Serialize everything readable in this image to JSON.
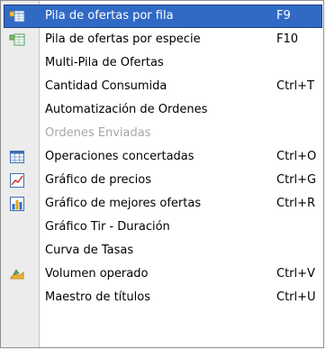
{
  "menu": {
    "items": [
      {
        "label": "Pila de ofertas por fila",
        "shortcut": "F9",
        "icon": "table-list-icon"
      },
      {
        "label": "Pila de ofertas por especie",
        "shortcut": "F10",
        "icon": "table-list-icon"
      },
      {
        "label": "Multi-Pila de Ofertas",
        "shortcut": ""
      },
      {
        "label": "Cantidad Consumida",
        "shortcut": "Ctrl+T"
      },
      {
        "label": "Automatización de Ordenes",
        "shortcut": ""
      },
      {
        "label": "Ordenes Enviadas",
        "shortcut": ""
      },
      {
        "label": "Operaciones concertadas",
        "shortcut": "Ctrl+O",
        "icon": "grid-icon"
      },
      {
        "label": "Gráfico de precios",
        "shortcut": "Ctrl+G",
        "icon": "line-chart-icon"
      },
      {
        "label": "Gráfico de mejores ofertas",
        "shortcut": "Ctrl+R",
        "icon": "bar-chart-icon"
      },
      {
        "label": "Gráfico Tir - Duración",
        "shortcut": ""
      },
      {
        "label": "Curva de Tasas",
        "shortcut": ""
      },
      {
        "label": "Volumen operado",
        "shortcut": "Ctrl+V",
        "icon": "volume-icon"
      },
      {
        "label": "Maestro de títulos",
        "shortcut": "Ctrl+U"
      }
    ]
  },
  "colors": {
    "selection": "#316ac5",
    "disabled": "#a6a6a6",
    "gutter": "#ececec"
  }
}
